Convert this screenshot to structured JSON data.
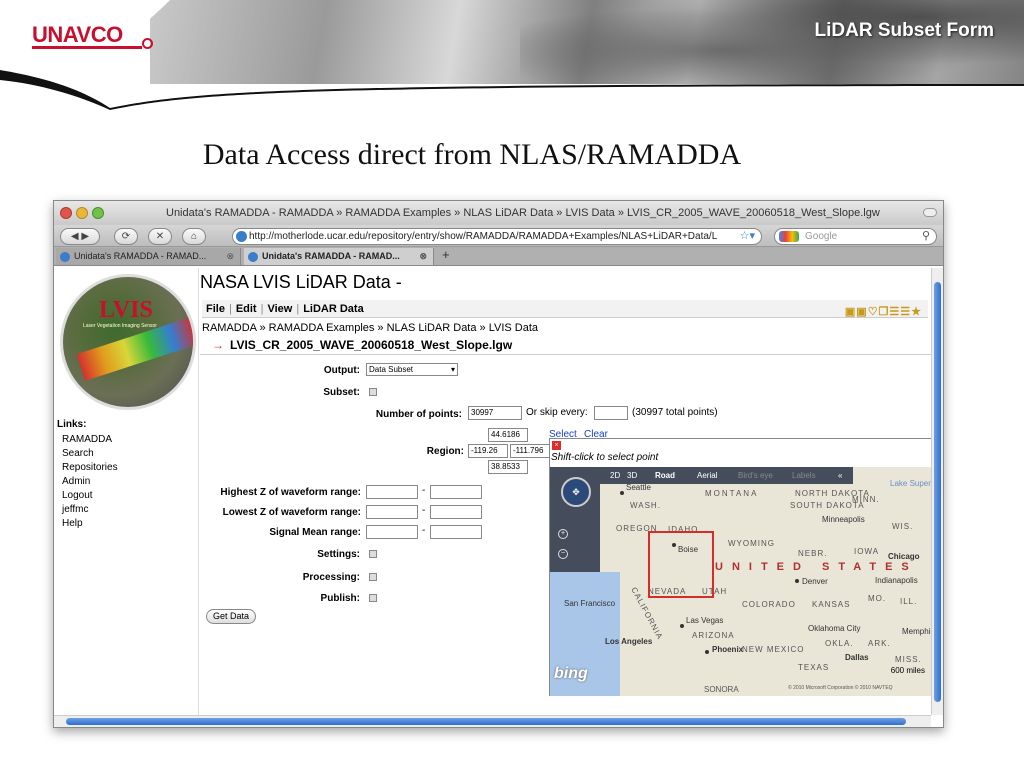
{
  "slide": {
    "logo": "UNAVCO",
    "tag": "LiDAR Subset Form",
    "title": "Data Access direct from NLAS/RAMADDA"
  },
  "browser": {
    "window_title": "Unidata's RAMADDA - RAMADDA » RAMADDA Examples » NLAS LiDAR Data » LVIS Data » LVIS_CR_2005_WAVE_20060518_West_Slope.lgw",
    "url": "http://motherlode.ucar.edu/repository/entry/show/RAMADDA/RAMADDA+Examples/NLAS+LiDAR+Data/L",
    "search_placeholder": "Google",
    "tabs": [
      {
        "label": "Unidata's RAMADDA - RAMAD..."
      },
      {
        "label": "Unidata's RAMADDA - RAMAD..."
      }
    ]
  },
  "sidebar": {
    "logo_text": "LVIS",
    "logo_sub": "Laser Vegetation Imaging Sensor",
    "links_title": "Links:",
    "links": [
      "RAMADDA",
      "Search",
      "Repositories",
      "Admin",
      "Logout",
      "jeffmc",
      "Help"
    ]
  },
  "page": {
    "title": "NASA LVIS LiDAR Data -",
    "menu": {
      "file": "File",
      "edit": "Edit",
      "view": "View",
      "lidar": "LiDAR Data"
    },
    "breadcrumb": "RAMADDA » RAMADDA Examples » NLAS LiDAR Data » LVIS Data",
    "entry_name": "LVIS_CR_2005_WAVE_20060518_West_Slope.lgw"
  },
  "form": {
    "output_label": "Output:",
    "output_value": "Data Subset",
    "subset_label": "Subset:",
    "num_points_label": "Number of points:",
    "num_points_value": "30997",
    "skip_label": "Or skip every:",
    "skip_value": "",
    "total_points": "(30997 total points)",
    "region_label": "Region:",
    "region_north": "44.6186",
    "region_west": "-119.26",
    "region_east": "-111.796",
    "region_south": "38.8533",
    "select_link": "Select",
    "clear_link": "Clear",
    "highest_z_label": "Highest Z of waveform range:",
    "lowest_z_label": "Lowest Z of waveform range:",
    "signal_mean_label": "Signal Mean range:",
    "range_sep": "-",
    "settings_label": "Settings:",
    "processing_label": "Processing:",
    "publish_label": "Publish:",
    "get_data_button": "Get Data"
  },
  "map": {
    "close_symbol": "×",
    "hint": "Shift-click to select point",
    "toolbar": {
      "view_2d": "2D",
      "view_3d": "3D",
      "road": "Road",
      "aerial": "Aerial",
      "birds_eye": "Bird's eye",
      "labels": "Labels",
      "collapse": "«"
    },
    "country_label": "UNITED STATES",
    "states": [
      "MONTANA",
      "NORTH DAKOTA",
      "SOUTH DAKOTA",
      "MINN.",
      "WIS.",
      "WASH.",
      "OREGON",
      "IDAHO",
      "WYOMING",
      "NEBR.",
      "IOWA",
      "NEVADA",
      "UTAH",
      "COLORADO",
      "KANSAS",
      "MO.",
      "ILL.",
      "CALIFORNIA",
      "ARIZONA",
      "NEW MEXICO",
      "OKLA.",
      "ARK.",
      "TEXAS",
      "MISS."
    ],
    "cities": [
      "Seattle",
      "Boise",
      "Minneapolis",
      "Chicago",
      "Indianapolis",
      "Denver",
      "San Francisco",
      "Las Vegas",
      "Los Angeles",
      "Phoenix",
      "Oklahoma City",
      "Dallas",
      "Memphis"
    ],
    "scale": "600 miles",
    "brand": "bing",
    "copyright": "© 2010 Microsoft Corporation  © 2010 NAVTEQ",
    "extra_labels": [
      "Lake Superior",
      "SONORA"
    ]
  }
}
